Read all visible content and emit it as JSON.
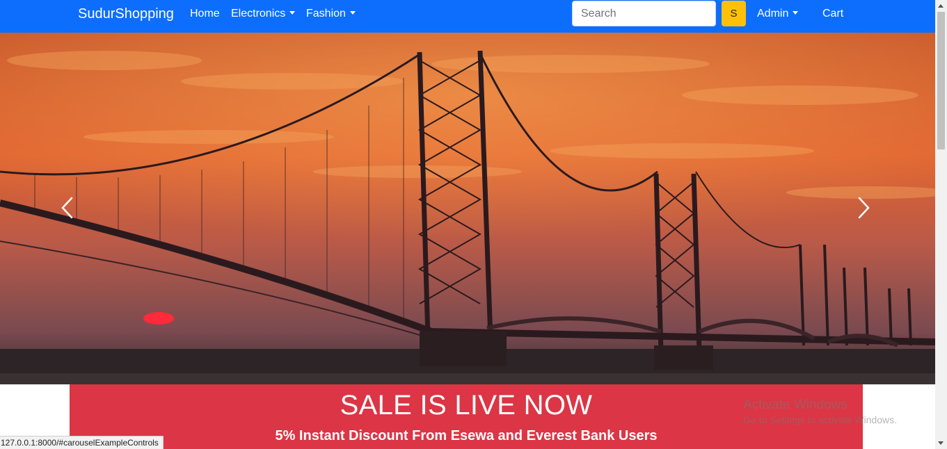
{
  "navbar": {
    "brand": "SudurShopping",
    "home": "Home",
    "electronics": "Electronics",
    "fashion": "Fashion",
    "search_placeholder": "Search",
    "search_button": "S",
    "admin": "Admin",
    "cart": "Cart",
    "color": "#0d6efd"
  },
  "carousel": {
    "prev_icon": "chevron-left-icon",
    "next_icon": "chevron-right-icon"
  },
  "sale": {
    "title": "SALE IS LIVE NOW",
    "subtitle": "5% Instant Discount From Esewa and Everest Bank Users",
    "color": "#dc3545"
  },
  "watermark": {
    "line1": "Activate Windows",
    "line2": "Go to Settings to activate Windows."
  },
  "status_bar": {
    "url": "127.0.0.1:8000/#carouselExampleControls"
  }
}
